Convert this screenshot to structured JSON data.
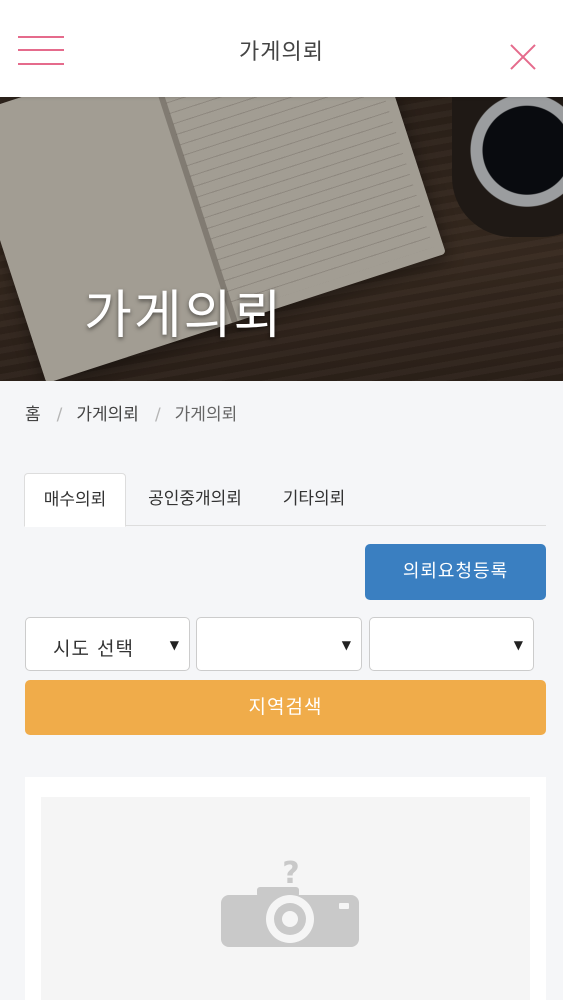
{
  "header": {
    "title": "가게의뢰",
    "menu_icon": "hamburger-icon",
    "close_icon": "close-icon",
    "accent_color": "#e56b8c"
  },
  "hero": {
    "title": "가게의뢰"
  },
  "breadcrumb": {
    "items": [
      "홈",
      "가게의뢰",
      "가게의뢰"
    ],
    "separator": "/"
  },
  "tabs": [
    {
      "label": "매수의뢰",
      "active": true
    },
    {
      "label": "공인중개의뢰",
      "active": false
    },
    {
      "label": "기타의뢰",
      "active": false
    }
  ],
  "actions": {
    "request_label": "의뢰요청등록",
    "request_color": "#3a7fc1",
    "search_label": "지역검색",
    "search_color": "#f0ac4a"
  },
  "filters": {
    "sido": {
      "value": "시도 선택"
    },
    "sigungu": {
      "value": ""
    },
    "dong": {
      "value": ""
    }
  },
  "listing": {
    "image_icon": "no-image-camera-icon"
  }
}
